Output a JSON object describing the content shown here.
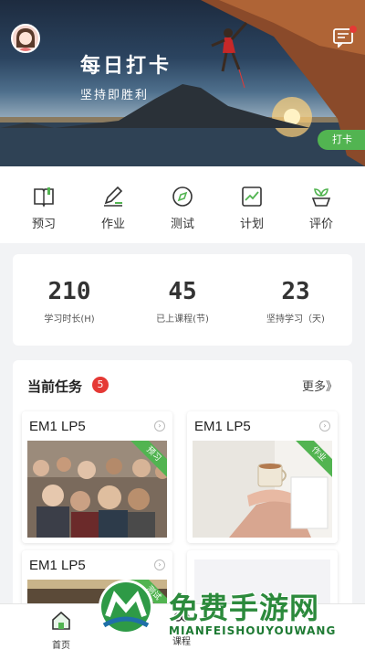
{
  "header": {
    "title": "每日打卡",
    "subtitle": "坚持即胜利",
    "checkin_label": "打卡"
  },
  "icons": {
    "avatar": "user-avatar",
    "messages": "message-icon"
  },
  "quicknav": [
    {
      "label": "预习",
      "icon": "book-icon"
    },
    {
      "label": "作业",
      "icon": "pencil-icon"
    },
    {
      "label": "测试",
      "icon": "compass-icon"
    },
    {
      "label": "计划",
      "icon": "chart-icon"
    },
    {
      "label": "评价",
      "icon": "plant-icon"
    }
  ],
  "stats": [
    {
      "value": "210",
      "label": "学习时长(H)"
    },
    {
      "value": "45",
      "label": "已上课程(节)"
    },
    {
      "value": "23",
      "label": "坚持学习（天)"
    }
  ],
  "tasks": {
    "title": "当前任务",
    "count": "5",
    "more_label": "更多》",
    "cards": [
      {
        "title": "EM1 LP5",
        "tag": "预习"
      },
      {
        "title": "EM1 LP5",
        "tag": "作业"
      },
      {
        "title": "EM1 LP5",
        "tag": "测试"
      }
    ]
  },
  "tabbar": {
    "home_label": "首页",
    "second_label": "课程"
  },
  "watermark": {
    "text": "免费手游网",
    "sub": "MIANFEISHOUYOUWANG"
  },
  "colors": {
    "accent": "#52b451",
    "badge": "#e53935",
    "watermark": "#2c8a3c"
  }
}
